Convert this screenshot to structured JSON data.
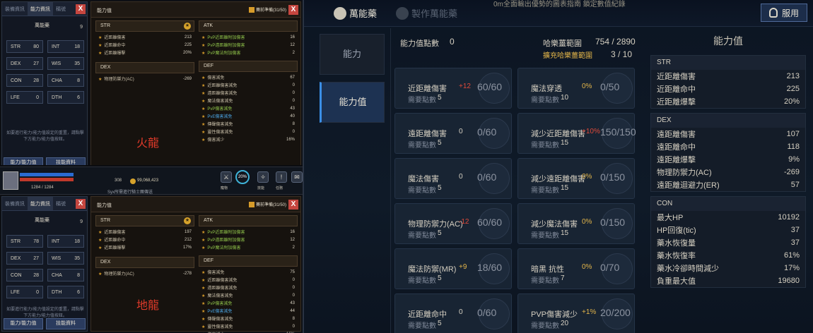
{
  "left": {
    "top_panel": {
      "tabs": [
        "裝備資訊",
        "能力資訊",
        "稱號"
      ],
      "char_name": "萬能藥",
      "char_level": "9",
      "stats": [
        [
          "STR",
          "80"
        ],
        [
          "INT",
          "18"
        ],
        [
          "DEX",
          "27"
        ],
        [
          "WIS",
          "35"
        ],
        [
          "CON",
          "28"
        ],
        [
          "CHA",
          "8"
        ],
        [
          "LFE",
          "0"
        ],
        [
          "DTH",
          "6"
        ]
      ],
      "hint": "如要進行能力/能力值設定的重置，請點擊下方能力/能力值按鈕。",
      "btn1": "能力/能力值",
      "btn2": "技能資料",
      "title": "能力值",
      "checkbox_label": "賽前準備(31/50)",
      "str_header": "STR",
      "str_items": [
        [
          "近距離傷害",
          "213"
        ],
        [
          "近距離命中",
          "225"
        ],
        [
          "近距離爆擊",
          "20%"
        ]
      ],
      "dex_header": "DEX",
      "dex_items": [
        [
          "物理防禦力(AC)",
          "-269"
        ]
      ],
      "atk_header": "ATK",
      "atk_items": [
        [
          "PvP近距離附加傷害",
          "16"
        ],
        [
          "PvP遠距離附加傷害",
          "12"
        ],
        [
          "PvP魔法附加傷害",
          "2"
        ]
      ],
      "def_header": "DEF",
      "def_items": [
        [
          "傷害減免",
          "67"
        ],
        [
          "近距離傷害減免",
          "0"
        ],
        [
          "遠距離傷害減免",
          "0"
        ],
        [
          "魔法傷害減免",
          "0"
        ],
        [
          "PvP傷害減免",
          "43"
        ],
        [
          "PvE傷害減免",
          "40"
        ],
        [
          "傳聲傷害減免",
          "8"
        ],
        [
          "靈性傷害減免",
          "0"
        ],
        [
          "傷害減少",
          "16%"
        ]
      ],
      "label": "火龍"
    },
    "status_bar": {
      "hp": "1284 / 1284",
      "level": "308",
      "money": "99,068,423",
      "buff": "Syx所需進行騎士團傳送",
      "icons": [
        "寵物",
        "技能",
        "任務",
        "信件"
      ]
    },
    "bottom_panel": {
      "tabs": [
        "裝備資訊",
        "能力資訊",
        "稱號"
      ],
      "char_name": "萬能藥",
      "char_level": "9",
      "stats": [
        [
          "STR",
          "78"
        ],
        [
          "INT",
          "18"
        ],
        [
          "DEX",
          "27"
        ],
        [
          "WIS",
          "35"
        ],
        [
          "CON",
          "28"
        ],
        [
          "CHA",
          "8"
        ],
        [
          "LFE",
          "0"
        ],
        [
          "DTH",
          "6"
        ]
      ],
      "hint": "如要進行能力/能力值設定的重置，請點擊下方能力/能力值按鈕。",
      "btn1": "能力/能力值",
      "btn2": "技能資料",
      "title": "能力值",
      "checkbox_label": "賽前準備(31/50)",
      "str_header": "STR",
      "str_items": [
        [
          "近距離傷害",
          "197"
        ],
        [
          "近距離命中",
          "212"
        ],
        [
          "近距離爆擊",
          "17%"
        ]
      ],
      "dex_header": "DEX",
      "dex_items": [
        [
          "物理防禦力(AC)",
          "-278"
        ]
      ],
      "atk_header": "ATK",
      "atk_items": [
        [
          "PvP近距離附加傷害",
          "16"
        ],
        [
          "PvP遠距離附加傷害",
          "12"
        ],
        [
          "PvP魔法附加傷害",
          "2"
        ]
      ],
      "def_header": "DEF",
      "def_items": [
        [
          "傷害減免",
          "75"
        ],
        [
          "近距離傷害減免",
          "0"
        ],
        [
          "遠距離傷害減免",
          "0"
        ],
        [
          "魔法傷害減免",
          "0"
        ],
        [
          "PvP傷害減免",
          "43"
        ],
        [
          "PvE傷害減免",
          "44"
        ],
        [
          "傳聲傷害減免",
          "8"
        ],
        [
          "靈性傷害減免",
          "0"
        ],
        [
          "傷害減少",
          "16%"
        ]
      ],
      "label": "地龍"
    }
  },
  "right": {
    "top_tabs": [
      "萬能藥",
      "製作萬能藥"
    ],
    "top_text": "0m全面輸出優勢的圖表指南 鎖定數值紀錄",
    "use_button": "服用",
    "side_nav": [
      "能力",
      "能力值"
    ],
    "points_label": "能力值點數",
    "points_value": "0",
    "hap_label": "哈樂薑範圍",
    "hap_value": "754 / 2890",
    "hap_sub": "擴充哈樂薑範圍",
    "hap_count": "3 / 10",
    "need_label": "需要點數",
    "cards": [
      {
        "name": "近距離傷害",
        "bonus": "+12",
        "bonus_color": "red",
        "progress": "60/60",
        "need": "5"
      },
      {
        "name": "魔法穿透",
        "bonus": "0%",
        "bonus_color": "org",
        "progress": "0/50",
        "need": "10"
      },
      {
        "name": "遠距離傷害",
        "bonus": "0",
        "bonus_color": "",
        "progress": "0/60",
        "need": "5"
      },
      {
        "name": "減少近距離傷害",
        "bonus": "+10%",
        "bonus_color": "red",
        "progress": "150/150",
        "need": "15"
      },
      {
        "name": "魔法傷害",
        "bonus": "0",
        "bonus_color": "",
        "progress": "0/60",
        "need": "5"
      },
      {
        "name": "減少遠距離傷害",
        "bonus": "0%",
        "bonus_color": "org",
        "progress": "0/150",
        "need": "15"
      },
      {
        "name": "物理防禦力(AC)",
        "bonus": "-12",
        "bonus_color": "red",
        "progress": "60/60",
        "need": "5"
      },
      {
        "name": "減少魔法傷害",
        "bonus": "0%",
        "bonus_color": "org",
        "progress": "0/150",
        "need": "15"
      },
      {
        "name": "魔法防禦(MR)",
        "bonus": "+9",
        "bonus_color": "org",
        "progress": "18/60",
        "need": "5"
      },
      {
        "name": "暗黑 抗性",
        "bonus": "0%",
        "bonus_color": "org",
        "progress": "0/70",
        "need": "7"
      },
      {
        "name": "近距離命中",
        "bonus": "0",
        "bonus_color": "",
        "progress": "0/60",
        "need": "5"
      },
      {
        "name": "PVP傷害減少",
        "bonus": "+1%",
        "bonus_color": "org",
        "progress": "20/200",
        "need": "20"
      }
    ],
    "stat_panel": {
      "title": "能力值",
      "sections": [
        {
          "name": "STR",
          "rows": [
            [
              "近距離傷害",
              "213"
            ],
            [
              "近距離命中",
              "225"
            ],
            [
              "近距離爆擊",
              "20%"
            ]
          ]
        },
        {
          "name": "DEX",
          "rows": [
            [
              "遠距離傷害",
              "107"
            ],
            [
              "遠距離命中",
              "118"
            ],
            [
              "遠距離爆擊",
              "9%"
            ],
            [
              "物理防禦力(AC)",
              "-269"
            ],
            [
              "遠距離迴避力(ER)",
              "57"
            ]
          ]
        },
        {
          "name": "CON",
          "rows": [
            [
              "最大HP",
              "10192"
            ],
            [
              "HP回復(tic)",
              "37"
            ],
            [
              "藥水恢復量",
              "37"
            ],
            [
              "藥水恢復率",
              "61%"
            ],
            [
              "藥水冷卻時間減少",
              "17%"
            ],
            [
              "負重最大值",
              "19680"
            ]
          ]
        }
      ]
    }
  }
}
